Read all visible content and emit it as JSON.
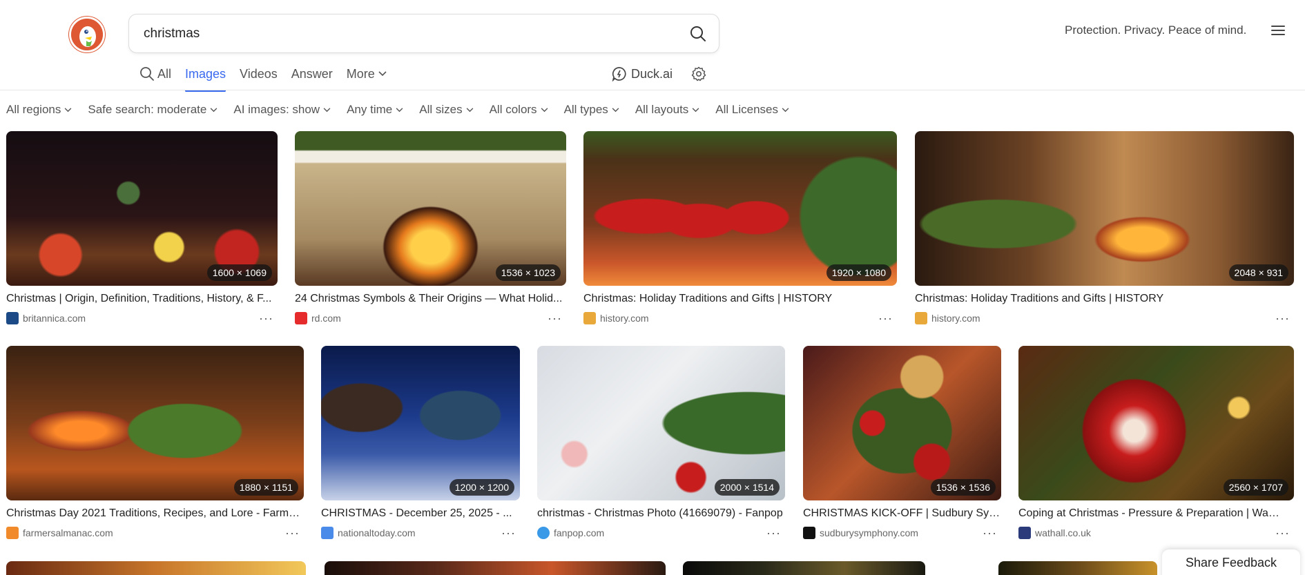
{
  "search": {
    "query": "christmas"
  },
  "header": {
    "tagline": "Protection. Privacy. Peace of mind."
  },
  "nav": {
    "tabs": [
      {
        "label": "All"
      },
      {
        "label": "Images"
      },
      {
        "label": "Videos"
      },
      {
        "label": "Answer"
      },
      {
        "label": "More"
      }
    ],
    "active": "Images",
    "duck_ai": "Duck.ai"
  },
  "filters": [
    "All regions",
    "Safe search: moderate",
    "AI images: show",
    "Any time",
    "All sizes",
    "All colors",
    "All types",
    "All layouts",
    "All Licenses"
  ],
  "results": [
    {
      "title": "Christmas | Origin, Definition, Traditions, History, & F...",
      "source": "britannica.com",
      "dimensions": "1600 × 1069"
    },
    {
      "title": "24 Christmas Symbols & Their Origins — What Holid...",
      "source": "rd.com",
      "dimensions": "1536 × 1023"
    },
    {
      "title": "Christmas: Holiday Traditions and Gifts | HISTORY",
      "source": "history.com",
      "dimensions": "1920 × 1080"
    },
    {
      "title": "Christmas: Holiday Traditions and Gifts | HISTORY",
      "source": "history.com",
      "dimensions": "2048 × 931"
    },
    {
      "title": "Christmas Day 2021 Traditions, Recipes, and Lore - Farme...",
      "source": "farmersalmanac.com",
      "dimensions": "1880 × 1151"
    },
    {
      "title": "CHRISTMAS - December 25, 2025 - ...",
      "source": "nationaltoday.com",
      "dimensions": "1200 × 1200"
    },
    {
      "title": "christmas - Christmas Photo (41669079) - Fanpop",
      "source": "fanpop.com",
      "dimensions": "2000 × 1514"
    },
    {
      "title": "CHRISTMAS KICK-OFF | Sudbury Sym...",
      "source": "sudburysymphony.com",
      "dimensions": "1536 × 1536"
    },
    {
      "title": "Coping at Christmas - Pressure & Preparation | Watha...",
      "source": "wathall.co.uk",
      "dimensions": "2560 × 1707"
    }
  ],
  "feedback": "Share Feedback",
  "colors": {
    "accent": "#3969ef",
    "logo": "#de5833"
  }
}
